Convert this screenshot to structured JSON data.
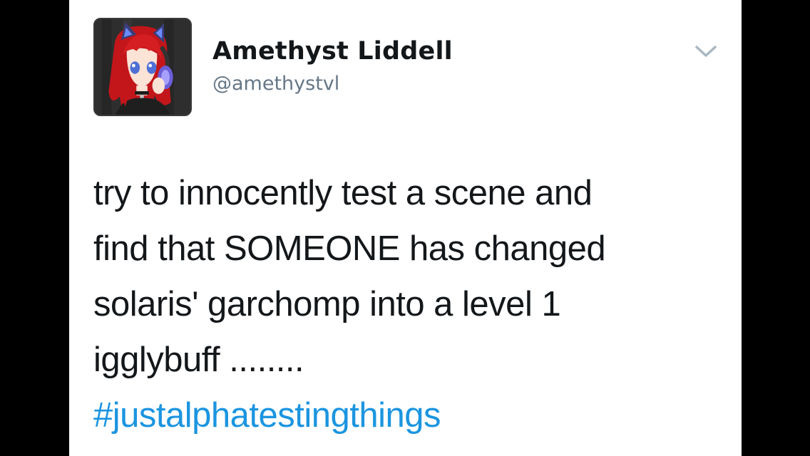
{
  "tweet": {
    "author_name": "Amethyst Liddell",
    "author_handle": "@amethystvl",
    "text_lines": [
      "try to innocently test a scene and",
      "find that SOMEONE has changed",
      "solaris' garchomp into a level 1",
      "igglybuff ........"
    ],
    "hashtag": "#justalphatestingthings",
    "menu_icon": "chevron-down-icon",
    "avatar": "avatar-illustration"
  },
  "colors": {
    "text": "#14171a",
    "handle": "#657786",
    "link": "#1b95e0",
    "background": "#ffffff",
    "frame": "#000000"
  }
}
